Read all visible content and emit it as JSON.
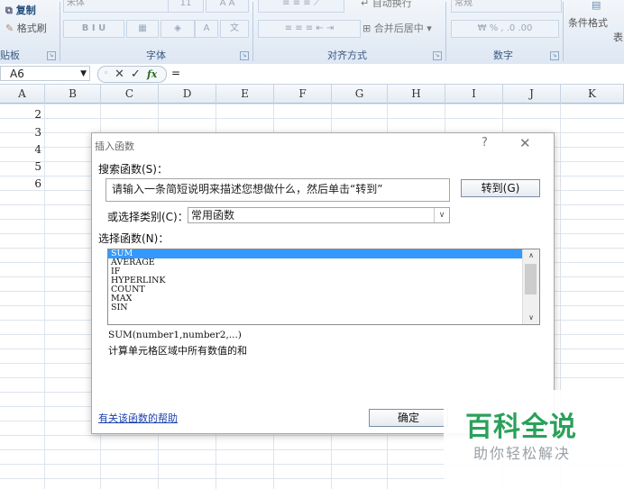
{
  "ribbon": {
    "clipboard": {
      "copy": "复制",
      "format_painter": "格式刷",
      "label": "贴板"
    },
    "font": {
      "font_name": "宋体",
      "font_size": "11",
      "label": "字体"
    },
    "alignment": {
      "wrap_text": "自动换行",
      "merge_center": "合并后居中",
      "label": "对齐方式"
    },
    "number": {
      "format": "常规",
      "label": "数字"
    },
    "styles": {
      "conditional_format": "条件格式",
      "table_partial": "表"
    }
  },
  "formula_bar": {
    "name_box": "A6",
    "content": "="
  },
  "columns": [
    "A",
    "B",
    "C",
    "D",
    "E",
    "F",
    "G",
    "H",
    "I",
    "J",
    "K"
  ],
  "cells": {
    "A": [
      "2",
      "3",
      "4",
      "5",
      "6"
    ]
  },
  "dialog": {
    "title": "插入函数",
    "help_icon": "?",
    "close_icon": "✕",
    "search_label": "搜索函数(S)：",
    "search_value": "请输入一条简短说明来描述您想做什么，然后单击“转到”",
    "go_button": "转到(G)",
    "category_label": "或选择类别(C)：",
    "category_value": "常用函数",
    "function_list_label": "选择函数(N)：",
    "functions": [
      "SUM",
      "AVERAGE",
      "IF",
      "HYPERLINK",
      "COUNT",
      "MAX",
      "SIN"
    ],
    "selected_function": "SUM",
    "syntax": "SUM(number1,number2,...)",
    "description": "计算单元格区域中所有数值的和",
    "help_link": "有关该函数的帮助",
    "ok_button": "确定"
  },
  "watermark": {
    "title": "百科全说",
    "subtitle": "助你轻松解决"
  },
  "colors": {
    "selection": "#3399ff",
    "link": "#1a3fb0",
    "watermark_green": "#2aa15a"
  }
}
